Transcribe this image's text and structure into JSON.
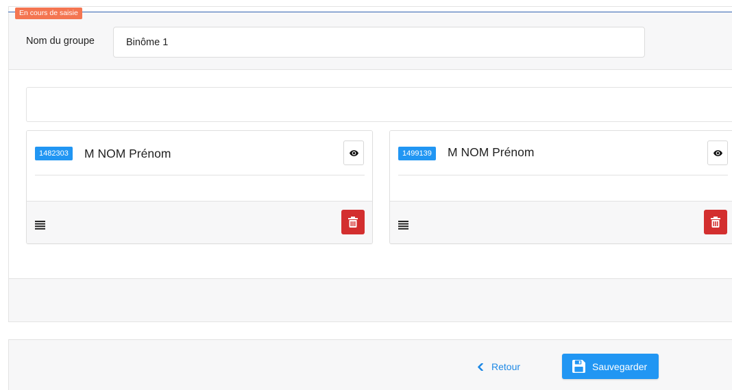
{
  "status_badge": "En cours de saisie",
  "group": {
    "name_label": "Nom du groupe",
    "name_value": "Binôme 1"
  },
  "members": [
    {
      "id": "1482303",
      "name": "M NOM Prénom"
    },
    {
      "id": "1499139",
      "name": "M NOM Prénom"
    }
  ],
  "footer": {
    "back_label": "Retour",
    "save_label": "Sauvegarder"
  },
  "colors": {
    "status_orange": "#f47551",
    "primary_blue": "#2196f3",
    "danger_red": "#d32f2f",
    "accent_line": "#2f5fb0"
  },
  "icons": {
    "view": "eye-icon",
    "list": "list-icon",
    "delete": "trash-icon",
    "back": "chevron-left-icon",
    "save": "floppy-disk-icon"
  }
}
